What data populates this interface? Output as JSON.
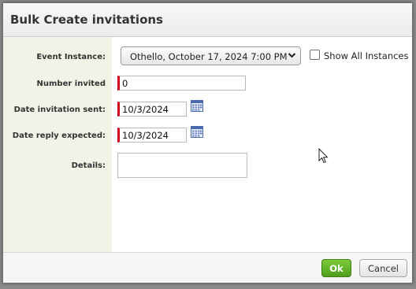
{
  "dialog": {
    "title": "Bulk Create invitations"
  },
  "form": {
    "event_instance_label": "Event Instance:",
    "event_instance_value": "Othello, October 17, 2024 7:00 PM",
    "show_all_label": "Show All Instances",
    "number_invited_label": "Number invited",
    "number_invited_value": "0",
    "date_sent_label": "Date invitation sent:",
    "date_sent_value": "10/3/2024",
    "date_reply_label": "Date reply expected:",
    "date_reply_value": "10/3/2024",
    "details_label": "Details:",
    "details_value": ""
  },
  "icons": {
    "calendar": "calendar-icon",
    "chevron": "chevron-down-icon",
    "cursor": "mouse-pointer-icon"
  },
  "footer": {
    "ok_label": "Ok",
    "cancel_label": "Cancel"
  },
  "colors": {
    "label_column": "#eff4e6",
    "ok_button": "#5cae26",
    "required_marker": "#d0021b"
  }
}
